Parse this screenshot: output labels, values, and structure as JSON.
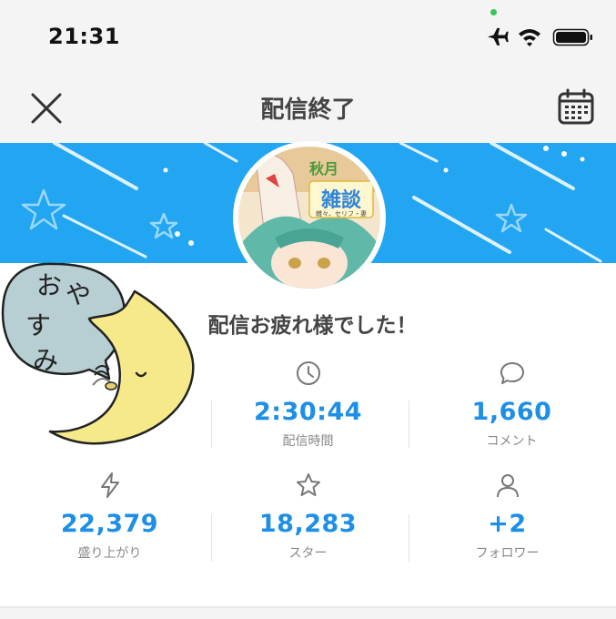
{
  "status_bar": {
    "time": "21:31",
    "icons": [
      "airplane-icon",
      "wifi-icon",
      "battery-icon"
    ]
  },
  "nav": {
    "title": "配信終了",
    "left_icon": "close-icon",
    "right_icon": "calendar-icon"
  },
  "banner": {
    "color": "#22a6f2",
    "avatar_text_top": "秋月",
    "avatar_text_main": "雑談",
    "avatar_text_sub": "雑々、セリフ・妻"
  },
  "greeting": "配信お疲れ様でした！",
  "sticker": {
    "text": [
      "お",
      "や",
      "す",
      "み"
    ]
  },
  "stats": [
    {
      "icon": "user-icon",
      "value": "",
      "label": ""
    },
    {
      "icon": "clock-icon",
      "value": "2:30:44",
      "label": "配信時間"
    },
    {
      "icon": "comment-icon",
      "value": "1,660",
      "label": "コメント"
    },
    {
      "icon": "bolt-icon",
      "value": "22,379",
      "label": "盛り上がり"
    },
    {
      "icon": "star-icon",
      "value": "18,283",
      "label": "スター"
    },
    {
      "icon": "person-icon",
      "value": "+2",
      "label": "フォロワー"
    }
  ],
  "colors": {
    "accent": "#1e8fe6",
    "banner": "#22a6f2",
    "label": "#888888"
  }
}
